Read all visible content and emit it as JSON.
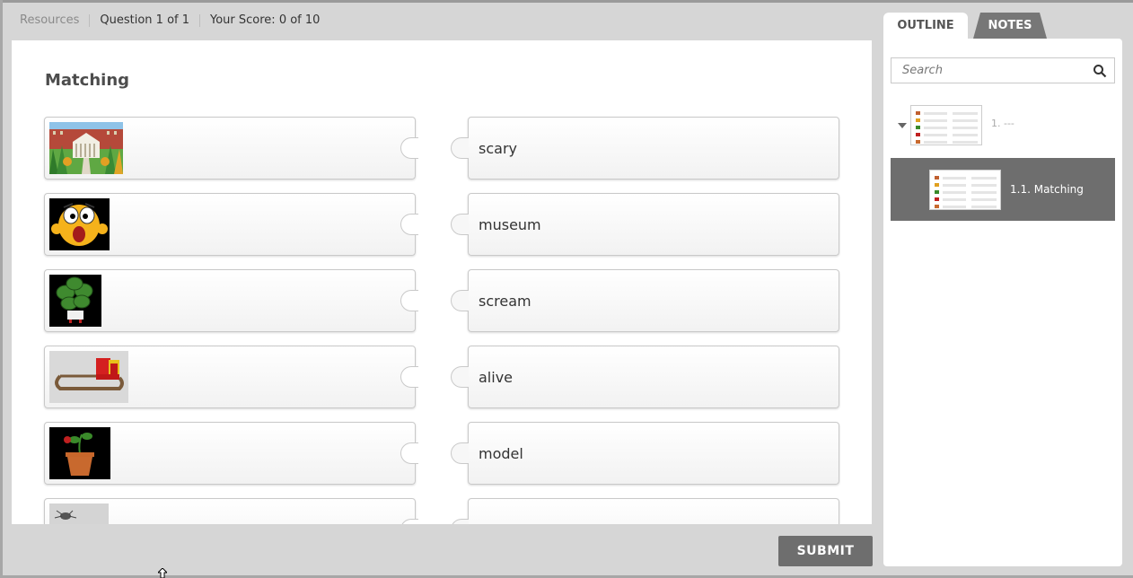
{
  "topbar": {
    "resources": "Resources",
    "question": "Question 1 of 1",
    "score": "Your Score: 0 of 10"
  },
  "question": {
    "title": "Matching",
    "left_items": [
      {
        "image": "museum-building-image"
      },
      {
        "image": "scared-face-image"
      },
      {
        "image": "plant-image"
      },
      {
        "image": "toy-train-image"
      },
      {
        "image": "potted-seedling-image"
      },
      {
        "image": "spider-image"
      }
    ],
    "right_items": [
      "scary",
      "museum",
      "scream",
      "alive",
      "model",
      "_partially_hidden_"
    ]
  },
  "buttons": {
    "submit": "SUBMIT"
  },
  "sidebar": {
    "tabs": {
      "outline": "OUTLINE",
      "notes": "NOTES"
    },
    "search": {
      "placeholder": "Search"
    },
    "outline": {
      "parent_label": "1. ---",
      "child_label": "1.1. Matching"
    }
  }
}
